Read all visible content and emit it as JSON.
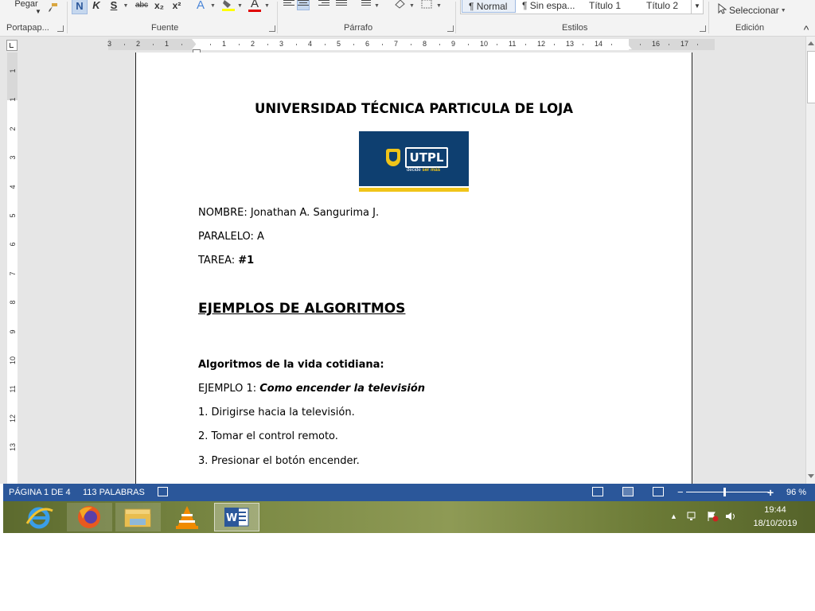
{
  "ribbon": {
    "clipboard": {
      "paste_label": "Pegar",
      "group_label": "Portapap..."
    },
    "font": {
      "group_label": "Fuente",
      "bold": "N",
      "italic": "K",
      "underline": "S",
      "strikethrough": "abc",
      "subscript": "x₂",
      "superscript": "x²",
      "text_effects": "A",
      "font_color": "A"
    },
    "paragraph": {
      "group_label": "Párrafo"
    },
    "styles": {
      "group_label": "Estilos",
      "items": [
        "¶ Normal",
        "¶ Sin espa...",
        "Título 1",
        "Título 2"
      ]
    },
    "editing": {
      "group_label": "Edición",
      "select_label": "Seleccionar"
    }
  },
  "ruler": {
    "h_labels": [
      "3",
      "2",
      "1",
      "1",
      "2",
      "3",
      "4",
      "5",
      "6",
      "7",
      "8",
      "9",
      "10",
      "11",
      "12",
      "13",
      "14",
      "16",
      "17"
    ],
    "v_labels": [
      "1",
      "1",
      "2",
      "3",
      "4",
      "5",
      "6",
      "7",
      "8",
      "9",
      "10",
      "11",
      "12",
      "13"
    ]
  },
  "document": {
    "title": "UNIVERSIDAD TÉCNICA PARTICULA DE LOJA",
    "logo": {
      "text": "UTPL",
      "tagline_a": "decide ",
      "tagline_b": "ser más"
    },
    "name_line": "NOMBRE: Jonathan A. Sangurima J.",
    "parallel_line": "PARALELO: A",
    "task_label": "TAREA: ",
    "task_value": "#1",
    "heading": "EJEMPLOS DE ALGORITMOS",
    "section_title": "Algoritmos de la vida cotidiana:",
    "example_label": "EJEMPLO 1: ",
    "example_title": "Como encender la televisión",
    "steps": [
      "1. Dirigirse hacia la televisión.",
      "2. Tomar el control remoto.",
      "3. Presionar el botón encender."
    ]
  },
  "status": {
    "page": "PÁGINA 1 DE 4",
    "words": "113 PALABRAS",
    "zoom_minus": "−",
    "zoom_plus": "+",
    "zoom": "96 %",
    "zoom_fraction": 0.46
  },
  "taskbar": {
    "apps": [
      "internet-explorer",
      "firefox",
      "file-explorer",
      "vlc",
      "word"
    ],
    "time": "19:44",
    "date": "18/10/2019"
  },
  "colors": {
    "statusbar": "#2b579a",
    "word_blue": "#2b579a",
    "utpl_blue": "#0e3f70",
    "utpl_yellow": "#f0c419"
  }
}
